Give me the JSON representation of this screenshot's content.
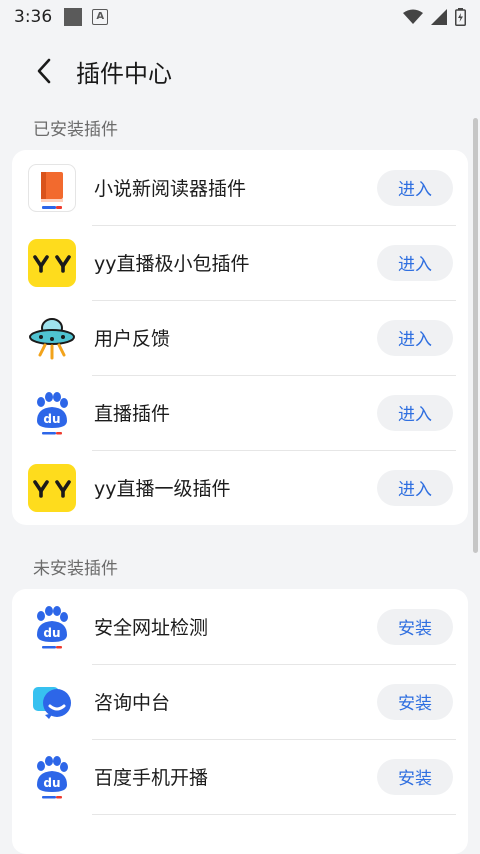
{
  "status": {
    "time": "3:36",
    "a_badge": "A"
  },
  "header": {
    "title": "插件中心"
  },
  "installed": {
    "title": "已安装插件",
    "items": [
      {
        "label": "小说新阅读器插件",
        "button": "进入",
        "icon": "book-icon"
      },
      {
        "label": "yy直播极小包插件",
        "button": "进入",
        "icon": "yy-logo-icon"
      },
      {
        "label": "用户反馈",
        "button": "进入",
        "icon": "ufo-icon"
      },
      {
        "label": "直播插件",
        "button": "进入",
        "icon": "baidu-paw-icon"
      },
      {
        "label": "yy直播一级插件",
        "button": "进入",
        "icon": "yy-logo-icon"
      }
    ]
  },
  "not_installed": {
    "title": "未安装插件",
    "items": [
      {
        "label": "安全网址检测",
        "button": "安装",
        "icon": "baidu-paw-icon"
      },
      {
        "label": "咨询中台",
        "button": "安装",
        "icon": "chat-bubble-icon"
      },
      {
        "label": "百度手机开播",
        "button": "安装",
        "icon": "baidu-paw-icon"
      }
    ]
  },
  "colors": {
    "accent": "#2f6fe0",
    "yy_yellow": "#fedc1d",
    "baidu_blue": "#2d66e8"
  }
}
